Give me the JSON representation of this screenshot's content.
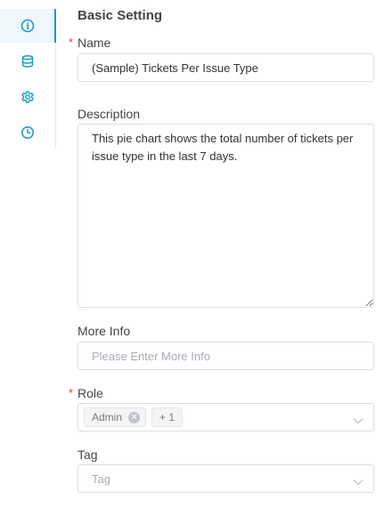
{
  "rail": {
    "items": [
      {
        "icon": "info-icon",
        "active": true
      },
      {
        "icon": "database-icon",
        "active": false
      },
      {
        "icon": "gear-icon",
        "active": false
      },
      {
        "icon": "clock-icon",
        "active": false
      }
    ],
    "accent_color": "#1f9ac4"
  },
  "form": {
    "section_title": "Basic Setting",
    "required_mark": "*",
    "name": {
      "label": "Name",
      "value": "(Sample) Tickets Per Issue Type"
    },
    "description": {
      "label": "Description",
      "value": "This pie chart shows the total number of tickets per issue type in the last 7 days."
    },
    "more_info": {
      "label": "More Info",
      "value": "",
      "placeholder": "Please Enter More Info"
    },
    "role": {
      "label": "Role",
      "tags": [
        "Admin"
      ],
      "more_count": "+ 1"
    },
    "tag": {
      "label": "Tag",
      "placeholder": "Tag"
    }
  }
}
